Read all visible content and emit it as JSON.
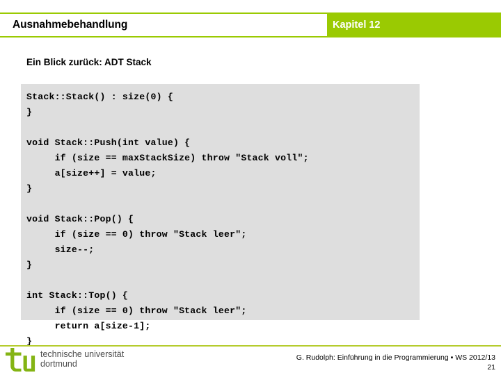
{
  "header": {
    "title": "Ausnahmebehandlung",
    "chapter": "Kapitel 12",
    "accent_color": "#9ACA02"
  },
  "subtitle": "Ein Blick zurück: ADT Stack",
  "code": {
    "background_color": "#dedede",
    "lines": [
      "Stack::Stack() : size(0) {",
      "}",
      "",
      "void Stack::Push(int value) {",
      "     if (size == maxStackSize) throw \"Stack voll\";",
      "     a[size++] = value;",
      "}",
      "",
      "void Stack::Pop() {",
      "     if (size == 0) throw \"Stack leer\";",
      "     size--;",
      "}",
      "",
      "int Stack::Top() {",
      "     if (size == 0) throw \"Stack leer\";",
      "     return a[size-1];",
      "}"
    ]
  },
  "footer": {
    "logo_line1": "technische universität",
    "logo_line2": "dortmund",
    "credit": "G. Rudolph: Einführung in die Programmierung ▪ WS 2012/13",
    "page_number": "21",
    "rule_color": "#b5cc2e"
  }
}
